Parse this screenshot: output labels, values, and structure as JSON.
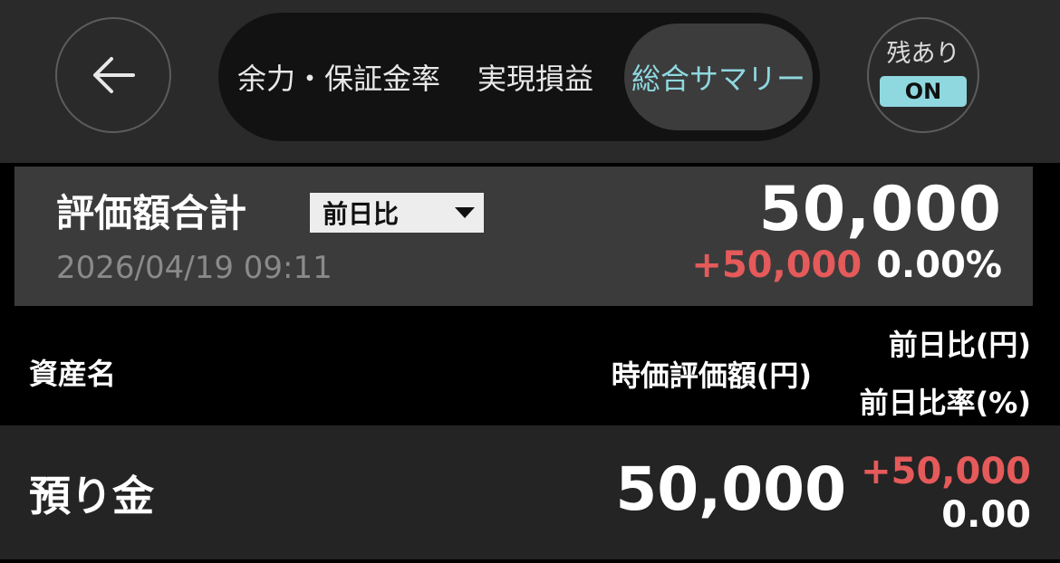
{
  "header": {
    "tabs": [
      {
        "label": "余力・保証金率",
        "active": false
      },
      {
        "label": "実現損益",
        "active": false
      },
      {
        "label": "総合サマリー",
        "active": true
      }
    ],
    "remaining_toggle": {
      "label": "残あり",
      "state": "ON"
    }
  },
  "summary": {
    "title": "評価額合計",
    "compare_select": "前日比",
    "timestamp": "2026/04/19 09:11",
    "total": "50,000",
    "change": "+50,000",
    "change_rate": "0.00%"
  },
  "columns": {
    "asset": "資産名",
    "value": "時価評価額(円)",
    "diff": "前日比(円)",
    "diff_rate": "前日比率(%)"
  },
  "rows": [
    {
      "name": "預り金",
      "value": "50,000",
      "diff": "+50,000",
      "diff_rate": "0.00"
    }
  ],
  "colors": {
    "accent": "#8fd8e0",
    "positive": "#e55a5a",
    "header_bg": "#2a2a2a",
    "summary_bg": "#3b3b3b"
  },
  "icons": {
    "back": "arrow-left-icon",
    "dropdown": "triangle-down-icon"
  }
}
